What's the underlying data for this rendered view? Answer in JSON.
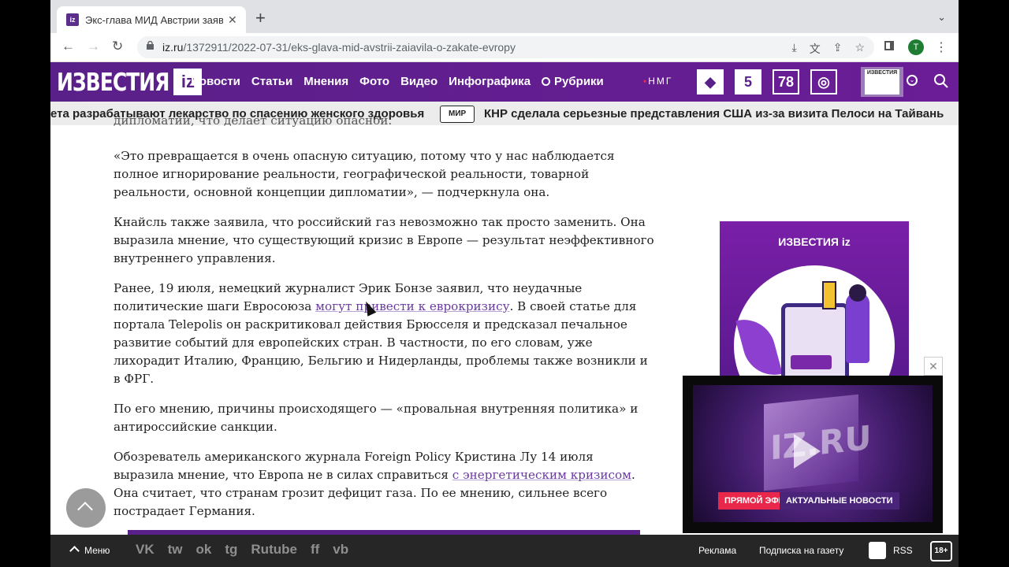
{
  "browser": {
    "tab_title": "Экс-глава МИД Австрии заяв...",
    "url_host": "iz.ru",
    "url_path": "/1372911/2022-07-31/eks-glava-mid-avstrii-zaiavila-o-zakate-evropy",
    "profile_initial": "T"
  },
  "site": {
    "logo_word": "ИЗВЕСТИЯ",
    "logo_mark": "iz",
    "nav": [
      "Новости",
      "Статьи",
      "Мнения",
      "Фото",
      "Видео",
      "Инфографика"
    ],
    "rubriki": "Рубрики",
    "nmg": "НМГ",
    "channels": [
      "5",
      "78"
    ],
    "newspaper_label": "ИЗВЕСТИЯ",
    "colors": {
      "brand": "#5a2089",
      "accent": "#e8274b"
    }
  },
  "ticker": {
    "item1": "ета разрабатывают лекарство по спасению женского здоровья",
    "badge": "МИР",
    "item2": "КНР сделала серьезные представления США из-за визита Пелоси на Тайвань"
  },
  "article": {
    "cut_line": "дипломатии, что делает ситуацию опасной.",
    "p1": "«Это превращается в очень опасную ситуацию, потому что у нас наблюдается полное игнорирование реальности, географической реальности, товарной реальности, основной концепции дипломатии», — подчеркнула она.",
    "p2": "Кнайсль также заявила, что российский газ невозможно так просто заменить. Она выразила мнение, что существующий кризис в Европе — результат неэффективного внутреннего управления.",
    "p3_before": "Ранее, 19 июля, немецкий журналист Эрик Бонзе заявил, что неудачные политические шаги Евросоюза ",
    "p3_link": "могут привести к еврокризису",
    "p3_after": ". В своей статье для портала Telepolis он раскритиковал действия Брюсселя и предсказал печальное развитие событий для европейских стран. В частности, по его словам, уже лихорадит Италию, Францию, Бельгию и Нидерланды, проблемы также возникли и в ФРГ.",
    "p4": "По его мнению, причины происходящего — «провальная внутренняя политика» и антироссийские санкции.",
    "p5_before": "Обозреватель американского журнала Foreign Policy Кристина Лу 14 июля выразила мнение, что Европа не в силах справиться ",
    "p5_link": "с энергетическим кризисом",
    "p5_after": ". Она считает, что странам грозит дефицит газа. По ее мнению, сильнее всего пострадает Германия."
  },
  "ad": {
    "logo": "ИЗВЕСТИЯ iz"
  },
  "video": {
    "live_label": "ПРЯМОЙ ЭФИР",
    "news_label": "АКТУАЛЬНЫЕ НОВОСТИ",
    "cube_text": "IZ.RU"
  },
  "footer": {
    "menu": "Меню",
    "socials": [
      "VK",
      "tw",
      "ok",
      "tg",
      "Rutube",
      "ff",
      "vb"
    ],
    "ads": "Реклама",
    "subscribe": "Подписка на газету",
    "rss": "RSS",
    "age": "18+"
  }
}
